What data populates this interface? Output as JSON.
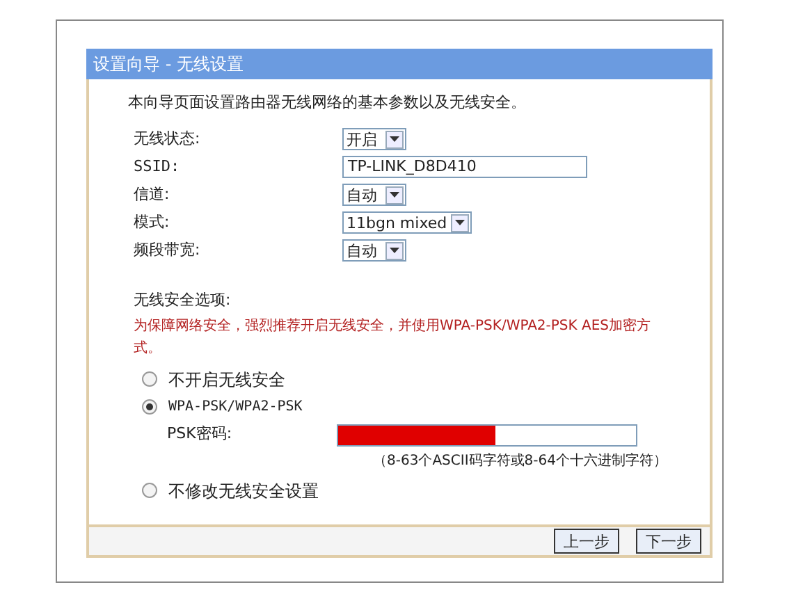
{
  "panel": {
    "title": "设置向导 - 无线设置"
  },
  "intro": "本向导页面设置路由器无线网络的基本参数以及无线安全。",
  "fields": [
    {
      "kind": "select",
      "label": "无线状态:",
      "value": "开启"
    },
    {
      "kind": "text",
      "label": "SSID:",
      "value": "TP-LINK_D8D410"
    },
    {
      "kind": "select",
      "label": "信道:",
      "value": "自动"
    },
    {
      "kind": "select",
      "label": "模式:",
      "value": "11bgn mixed"
    },
    {
      "kind": "select",
      "label": "频段带宽:",
      "value": "自动"
    }
  ],
  "security": {
    "title": "无线安全选项:",
    "warning": "为保障网络安全，强烈推荐开启无线安全，并使用WPA-PSK/WPA2-PSK AES加密方式。",
    "options": [
      {
        "label": "不开启无线安全",
        "selected": false
      },
      {
        "label": "WPA-PSK/WPA2-PSK",
        "selected": true
      },
      {
        "label": "不修改无线安全设置",
        "selected": false
      }
    ],
    "psk_label": "PSK密码:",
    "psk_hint": "（8-63个ASCII码字符或8-64个十六进制字符）"
  },
  "buttons": [
    "上一步",
    "下一步"
  ]
}
